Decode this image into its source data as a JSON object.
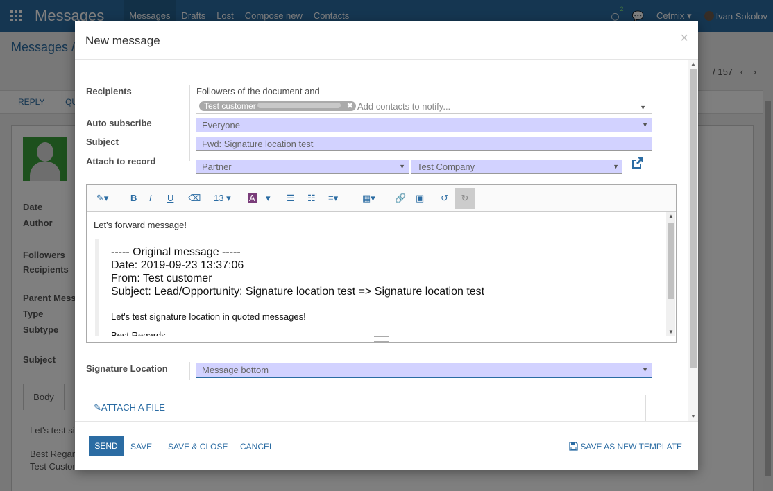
{
  "navbar": {
    "app_title": "Messages",
    "menu": [
      "Messages",
      "Drafts",
      "Lost",
      "Compose new",
      "Contacts"
    ],
    "activity_badge": "2",
    "company": "Cetmix",
    "user": "Ivan Sokolov",
    "apps_icon": "grid-icon",
    "activity_icon": "clock-icon",
    "chat_icon": "chat-icon"
  },
  "background": {
    "breadcrumb": "Messages /",
    "pager": "/ 157",
    "actions": [
      "REPLY",
      "QUO"
    ],
    "labels": [
      "Date",
      "Author",
      "Followers",
      "Recipients",
      "Parent Messa",
      "Type",
      "Subtype",
      "Subject"
    ],
    "tab": "Body",
    "body_lines": [
      "Let's test si",
      "Best Regarc",
      "Test Custom"
    ]
  },
  "modal": {
    "title": "New message",
    "close": "×",
    "recipients": {
      "label": "Recipients",
      "followers_text": "Followers of the document and",
      "tag": "Test customer",
      "tag_suffix": "...",
      "placeholder": "Add contacts to notify..."
    },
    "auto_subscribe": {
      "label": "Auto subscribe",
      "value": "Everyone"
    },
    "subject": {
      "label": "Subject",
      "value": "Fwd: Signature location test"
    },
    "attach_to_record": {
      "label": "Attach to record",
      "model": "Partner",
      "record": "Test Company",
      "link_icon": "external-link-icon"
    },
    "toolbar": {
      "font_size": "13",
      "icons": [
        "magic-wand-icon",
        "bold-icon",
        "italic-icon",
        "underline-icon",
        "eraser-icon",
        "font-size-dropdown",
        "text-color-icon",
        "bullet-list-icon",
        "numbered-list-icon",
        "align-icon",
        "table-icon",
        "link-icon",
        "image-icon",
        "undo-icon",
        "redo-icon"
      ]
    },
    "editor": {
      "first_line": "Let's forward message!",
      "quote_header": "----- Original message -----",
      "quote_date": "Date: 2019-09-23 13:37:06",
      "quote_from": "From: Test customer",
      "quote_subject": "Subject: Lead/Opportunity: Signature location test => Signature location test",
      "quote_body": "Let's test signature location in quoted messages!",
      "quote_cut": "Best Regards"
    },
    "signature_location": {
      "label": "Signature Location",
      "value": "Message bottom"
    },
    "attach_file": "ATTACH A FILE",
    "footer": {
      "send": "SEND",
      "save": "SAVE",
      "save_close": "SAVE & CLOSE",
      "cancel": "CANCEL",
      "save_template": "SAVE AS NEW TEMPLATE"
    }
  }
}
